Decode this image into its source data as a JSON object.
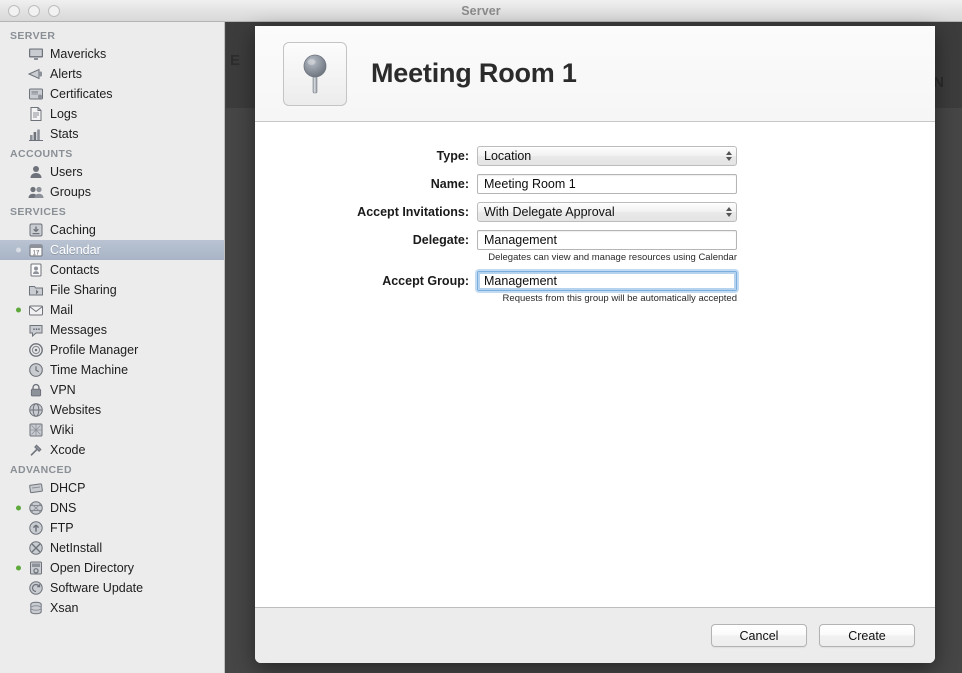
{
  "window": {
    "title": "Server",
    "traffic_lights": [
      "close-button",
      "minimize-button",
      "zoom-button"
    ]
  },
  "sidebar": {
    "groups": [
      {
        "title": "SERVER",
        "items": [
          {
            "label": "Mavericks",
            "icon": "display-icon",
            "status": null,
            "selected": false
          },
          {
            "label": "Alerts",
            "icon": "megaphone-icon",
            "status": null,
            "selected": false
          },
          {
            "label": "Certificates",
            "icon": "certificate-icon",
            "status": null,
            "selected": false
          },
          {
            "label": "Logs",
            "icon": "document-icon",
            "status": null,
            "selected": false
          },
          {
            "label": "Stats",
            "icon": "bar-chart-icon",
            "status": null,
            "selected": false
          }
        ]
      },
      {
        "title": "ACCOUNTS",
        "items": [
          {
            "label": "Users",
            "icon": "user-icon",
            "status": null,
            "selected": false
          },
          {
            "label": "Groups",
            "icon": "group-icon",
            "status": null,
            "selected": false
          }
        ]
      },
      {
        "title": "SERVICES",
        "items": [
          {
            "label": "Caching",
            "icon": "download-box-icon",
            "status": null,
            "selected": false
          },
          {
            "label": "Calendar",
            "icon": "calendar-icon",
            "status": "gray",
            "selected": true
          },
          {
            "label": "Contacts",
            "icon": "contacts-icon",
            "status": null,
            "selected": false
          },
          {
            "label": "File Sharing",
            "icon": "file-sharing-icon",
            "status": null,
            "selected": false
          },
          {
            "label": "Mail",
            "icon": "mail-icon",
            "status": "green",
            "selected": false
          },
          {
            "label": "Messages",
            "icon": "messages-icon",
            "status": null,
            "selected": false
          },
          {
            "label": "Profile Manager",
            "icon": "profile-manager-icon",
            "status": null,
            "selected": false
          },
          {
            "label": "Time Machine",
            "icon": "clock-icon",
            "status": null,
            "selected": false
          },
          {
            "label": "VPN",
            "icon": "lock-icon",
            "status": null,
            "selected": false
          },
          {
            "label": "Websites",
            "icon": "globe-icon",
            "status": null,
            "selected": false
          },
          {
            "label": "Wiki",
            "icon": "wiki-icon",
            "status": null,
            "selected": false
          },
          {
            "label": "Xcode",
            "icon": "hammer-icon",
            "status": null,
            "selected": false
          }
        ]
      },
      {
        "title": "ADVANCED",
        "items": [
          {
            "label": "DHCP",
            "icon": "dhcp-icon",
            "status": null,
            "selected": false
          },
          {
            "label": "DNS",
            "icon": "dns-icon",
            "status": "green",
            "selected": false
          },
          {
            "label": "FTP",
            "icon": "ftp-icon",
            "status": null,
            "selected": false
          },
          {
            "label": "NetInstall",
            "icon": "netinstall-icon",
            "status": null,
            "selected": false
          },
          {
            "label": "Open Directory",
            "icon": "open-directory-icon",
            "status": "green",
            "selected": false
          },
          {
            "label": "Software Update",
            "icon": "software-update-icon",
            "status": null,
            "selected": false
          },
          {
            "label": "Xsan",
            "icon": "xsan-icon",
            "status": null,
            "selected": false
          }
        ]
      }
    ]
  },
  "background": {
    "peek_text_right": "N",
    "peek_text_left": "E"
  },
  "sheet": {
    "icon": "map-pin-icon",
    "title": "Meeting Room 1",
    "fields": {
      "type": {
        "label": "Type:",
        "control": "popup",
        "value": "Location"
      },
      "name": {
        "label": "Name:",
        "control": "textfield",
        "value": "Meeting Room 1"
      },
      "accept_invitations": {
        "label": "Accept Invitations:",
        "control": "popup",
        "value": "With Delegate Approval"
      },
      "delegate": {
        "label": "Delegate:",
        "control": "textfield",
        "value": "Management",
        "help": "Delegates can view and manage resources using Calendar"
      },
      "accept_group": {
        "label": "Accept Group:",
        "control": "textfield",
        "value": "Management",
        "help": "Requests from this group will be automatically accepted",
        "focused": true
      }
    },
    "footer": {
      "cancel_label": "Cancel",
      "create_label": "Create"
    }
  },
  "colors": {
    "selection": "#b0bbcc",
    "status_running": "#5ea83c",
    "status_idle": "#d9dde4",
    "focus_ring": "#7aaede",
    "dim_backdrop": "#464646"
  }
}
